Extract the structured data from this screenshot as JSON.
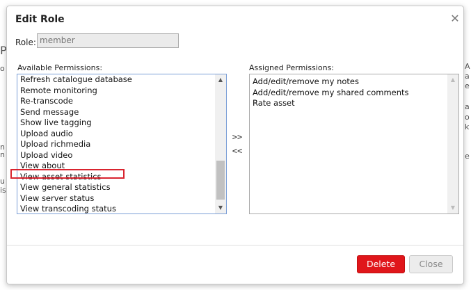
{
  "dialog": {
    "title": "Edit Role",
    "role_label": "Role:",
    "role_value": "member"
  },
  "available": {
    "label": "Available Permissions:",
    "items": [
      "Refresh catalogue database",
      "Remote monitoring",
      "Re-transcode",
      "Send message",
      "Show live tagging",
      "Upload audio",
      "Upload richmedia",
      "Upload video",
      "View about",
      "View asset statistics",
      "View general statistics",
      "View server status",
      "View transcoding status"
    ],
    "highlighted_item": "View asset statistics"
  },
  "assigned": {
    "label": "Assigned Permissions:",
    "items": [
      "Add/edit/remove my notes",
      "Add/edit/remove my shared comments",
      "Rate asset"
    ]
  },
  "controls": {
    "add_label": ">>",
    "remove_label": "<<"
  },
  "buttons": {
    "delete_label": "Delete",
    "close_label": "Close"
  },
  "background": {
    "left_fragments": [
      "P",
      "o",
      "n",
      "n",
      "u",
      "is"
    ],
    "right_fragments": [
      "A",
      "a",
      "e",
      "a",
      "o",
      "k",
      "e"
    ]
  },
  "colors": {
    "delete_bg": "#e0161b",
    "highlight_border": "#d9242f",
    "focus_border": "#7a9ed6"
  }
}
